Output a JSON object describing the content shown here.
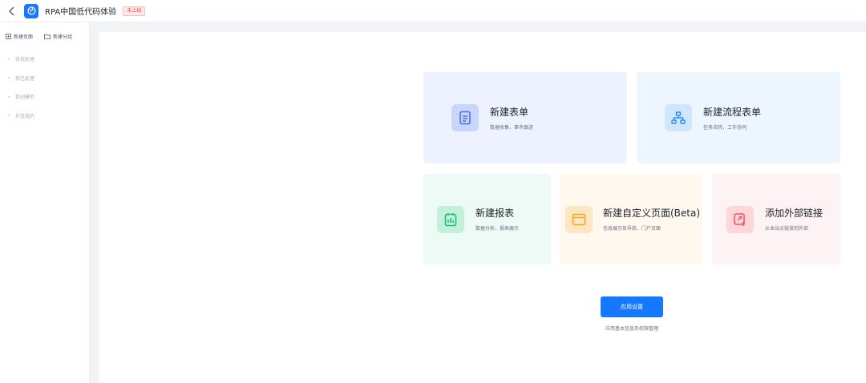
{
  "header": {
    "title": "RPA中国低代码体验",
    "status_badge": "未上线"
  },
  "sidebar": {
    "actions": [
      {
        "label": "新建页面",
        "icon": "new-page-icon"
      },
      {
        "label": "新建分组",
        "icon": "folder-icon"
      }
    ],
    "items": [
      {
        "label": "待我处理"
      },
      {
        "label": "我已处理"
      },
      {
        "label": "我创建的"
      },
      {
        "label": "抄送我的"
      }
    ]
  },
  "cards": {
    "form": {
      "title": "新建表单",
      "desc": "数据收集，事件跟进",
      "icon": "document-icon",
      "color": "#4d6cf0"
    },
    "flow": {
      "title": "新建流程表单",
      "desc": "任务流转，工作协同",
      "icon": "flow-icon",
      "color": "#2a8df5"
    },
    "report": {
      "title": "新建报表",
      "desc": "数据分析，报表展示",
      "icon": "chart-icon",
      "color": "#1fbf7a"
    },
    "custom": {
      "title": "新建自定义页面(Beta)",
      "desc": "信息展示及导航、门户页面",
      "icon": "window-icon",
      "color": "#f5a623"
    },
    "link": {
      "title": "添加外部链接",
      "desc": "从本站点链接到外部",
      "icon": "link-icon",
      "color": "#f0566a"
    }
  },
  "settings": {
    "button_label": "应用设置",
    "desc": "应用基本信息及权限管理"
  },
  "colors": {
    "primary": "#1677ff",
    "badge": "#f53f3f"
  }
}
